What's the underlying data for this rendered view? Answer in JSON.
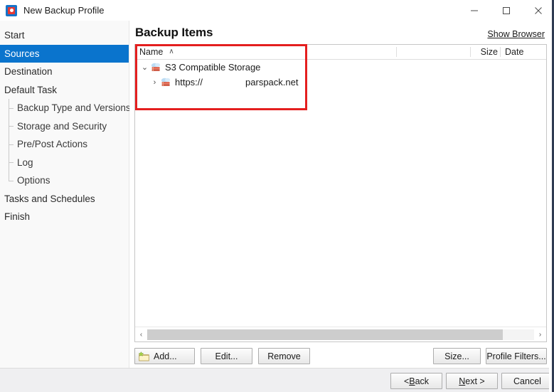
{
  "window": {
    "title": "New Backup Profile",
    "icon": "backup-app-icon",
    "controls": {
      "minimize": "minimize-icon",
      "maximize": "maximize-icon",
      "close": "close-icon"
    }
  },
  "sidebar": {
    "items": [
      {
        "label": "Start",
        "level": 0,
        "selected": false
      },
      {
        "label": "Sources",
        "level": 0,
        "selected": true
      },
      {
        "label": "Destination",
        "level": 0,
        "selected": false
      },
      {
        "label": "Default Task",
        "level": 0,
        "selected": false
      },
      {
        "label": "Backup Type and Versions",
        "level": 1,
        "selected": false
      },
      {
        "label": "Storage and Security",
        "level": 1,
        "selected": false
      },
      {
        "label": "Pre/Post Actions",
        "level": 1,
        "selected": false
      },
      {
        "label": "Log",
        "level": 1,
        "selected": false
      },
      {
        "label": "Options",
        "level": 1,
        "selected": false
      },
      {
        "label": "Tasks and Schedules",
        "level": 0,
        "selected": false
      },
      {
        "label": "Finish",
        "level": 0,
        "selected": false
      }
    ]
  },
  "main": {
    "title": "Backup Items",
    "show_browser_link": "Show Browser",
    "list": {
      "columns": [
        {
          "key": "name",
          "label": "Name",
          "sort": "ascending",
          "sort_glyph": "∧"
        },
        {
          "key": "blank",
          "label": ""
        },
        {
          "key": "size",
          "label": "Size"
        },
        {
          "key": "date",
          "label": "Date"
        }
      ],
      "rows": [
        {
          "label": "S3 Compatible Storage",
          "label_secondary": "",
          "level": 1,
          "expanded": true,
          "twisty_glyph": "⌄",
          "icon": "cloud-storage-icon",
          "size": "",
          "date": ""
        },
        {
          "label": "https://",
          "label_secondary": "parspack.net",
          "level": 2,
          "expanded": false,
          "twisty_glyph": "›",
          "icon": "cloud-storage-icon",
          "size": "",
          "date": ""
        }
      ]
    },
    "scrollbar": {
      "left_arrow": "‹",
      "right_arrow": "›",
      "thumb_percent": 92
    },
    "buttons": {
      "add": "Add...",
      "add_icon": "add-folder-icon",
      "edit": "Edit...",
      "remove": "Remove",
      "size": "Size...",
      "profile_filters": "Profile Filters..."
    }
  },
  "footer": {
    "back": {
      "prefix": "< ",
      "accel": "B",
      "suffix": "ack"
    },
    "next": {
      "prefix": "",
      "accel": "N",
      "suffix": "ext >"
    },
    "cancel": "Cancel"
  },
  "annotation": {
    "type": "highlight-rectangle",
    "color": "#e41f1f"
  },
  "colors": {
    "accent": "#0a74cd",
    "sidebar_bg": "#f9f9f9",
    "footer_bg": "#efeff1",
    "annotation": "#e41f1f"
  }
}
